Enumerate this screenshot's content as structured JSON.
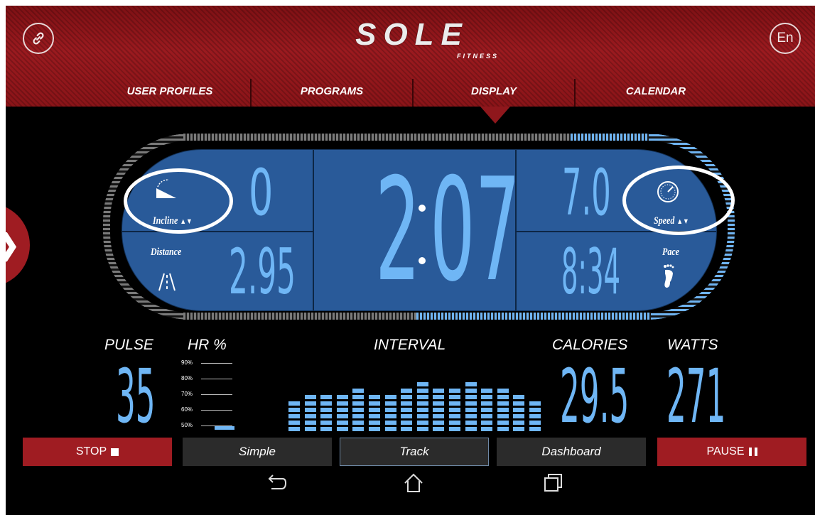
{
  "header": {
    "left_icon": "link-icon",
    "logo_main": "SOLE",
    "logo_sub": "FITNESS",
    "lang_button": "En"
  },
  "nav": {
    "tabs": [
      {
        "label": "USER PROFILES"
      },
      {
        "label": "PROGRAMS"
      },
      {
        "label": "DISPLAY",
        "active": true
      },
      {
        "label": "CALENDAR"
      }
    ]
  },
  "display": {
    "incline_label": "Incline",
    "incline_value": "0",
    "distance_label": "Distance",
    "distance_value": "2.95",
    "time_minutes": "2",
    "time_seconds": "07",
    "speed_label": "Speed",
    "speed_value": "7.0",
    "pace_label": "Pace",
    "pace_value": "8:34",
    "sort_icon": "▲▼"
  },
  "stats": {
    "pulse_label": "PULSE",
    "pulse_value": "35",
    "hr_label": "HR %",
    "hr_scale": [
      "90%",
      "80%",
      "70%",
      "60%",
      "50%"
    ],
    "interval_label": "INTERVAL",
    "interval_levels": [
      2,
      3,
      3,
      3,
      4,
      3,
      3,
      4,
      5,
      4,
      4,
      5,
      4,
      4,
      3,
      2
    ],
    "calories_label": "CALORIES",
    "calories_value": "29.5",
    "watts_label": "WATTS",
    "watts_value": "271"
  },
  "controls": {
    "stop_label": "STOP",
    "simple_label": "Simple",
    "track_label": "Track",
    "dashboard_label": "Dashboard",
    "pause_label": "PAUSE"
  },
  "colors": {
    "accent_red": "#9f1c22",
    "display_blue": "#295a99",
    "digit_blue": "#6fb6f5"
  }
}
